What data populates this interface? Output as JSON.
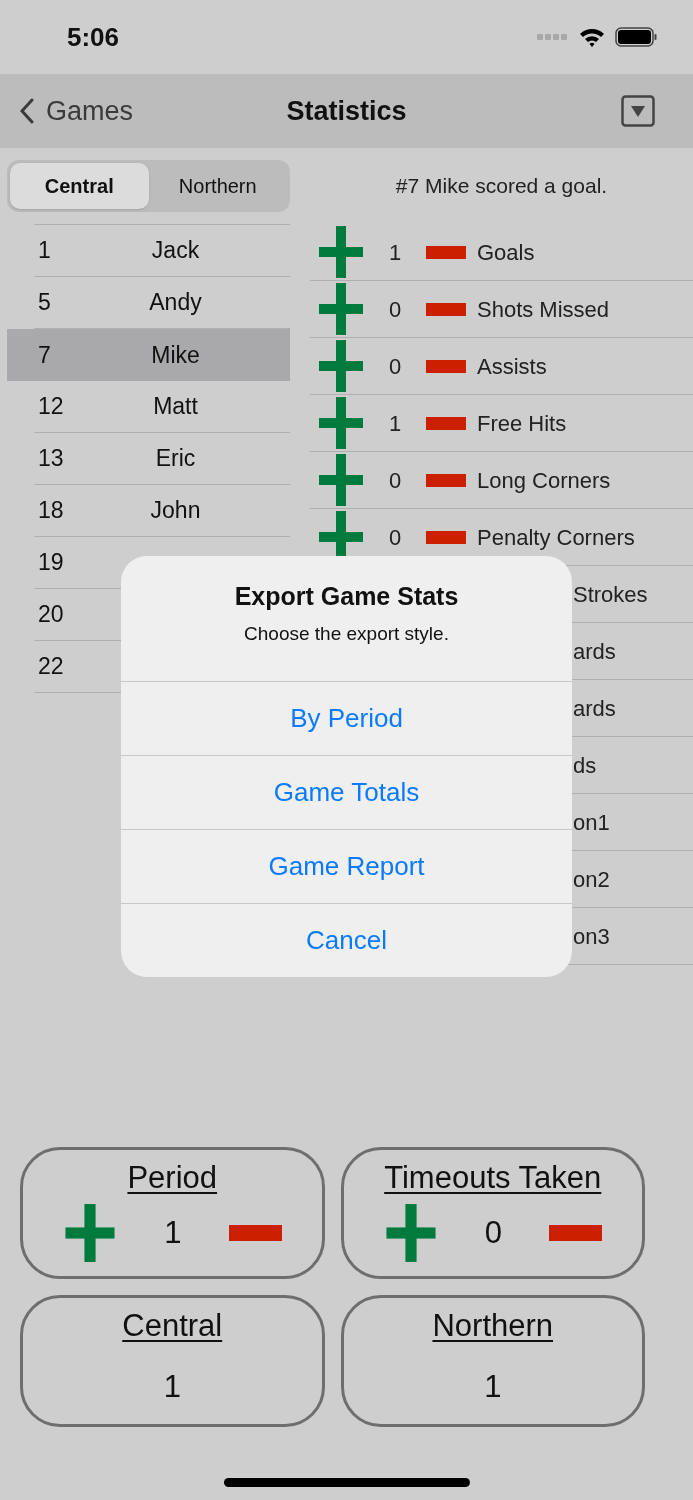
{
  "status_bar": {
    "time": "5:06"
  },
  "nav": {
    "back_label": "Games",
    "title": "Statistics"
  },
  "teams": [
    {
      "label": "Central",
      "selected": true
    },
    {
      "label": "Northern",
      "selected": false
    }
  ],
  "message": "#7 Mike scored a goal.",
  "players": [
    {
      "number": "1",
      "name": "Jack",
      "selected": false
    },
    {
      "number": "5",
      "name": "Andy",
      "selected": false
    },
    {
      "number": "7",
      "name": "Mike",
      "selected": true
    },
    {
      "number": "12",
      "name": "Matt",
      "selected": false
    },
    {
      "number": "13",
      "name": "Eric",
      "selected": false
    },
    {
      "number": "18",
      "name": "John",
      "selected": false
    },
    {
      "number": "19",
      "selected": false
    },
    {
      "number": "20",
      "selected": false
    },
    {
      "number": "22",
      "selected": false
    }
  ],
  "stats": [
    {
      "kind": "full",
      "value": "1",
      "label": "Goals"
    },
    {
      "kind": "full",
      "value": "0",
      "label": "Shots Missed"
    },
    {
      "kind": "full",
      "value": "0",
      "label": "Assists"
    },
    {
      "kind": "full",
      "value": "1",
      "label": "Free Hits"
    },
    {
      "kind": "full",
      "value": "0",
      "label": "Long Corners"
    },
    {
      "kind": "full",
      "value": "0",
      "label": "Penalty Corners"
    },
    {
      "kind": "covered",
      "label": "Strokes"
    },
    {
      "kind": "covered",
      "label": "ards"
    },
    {
      "kind": "covered",
      "label": "ards"
    },
    {
      "kind": "covered",
      "label": "ds"
    },
    {
      "kind": "covered",
      "label": "on1"
    },
    {
      "kind": "covered",
      "label": "on2"
    },
    {
      "kind": "covered",
      "label": "on3"
    }
  ],
  "dialog": {
    "title": "Export Game Stats",
    "message": "Choose the export style.",
    "actions": [
      "By Period",
      "Game Totals",
      "Game Report",
      "Cancel"
    ]
  },
  "counters": [
    {
      "kind": "stepper",
      "title": "Period",
      "value": "1"
    },
    {
      "kind": "stepper",
      "title": "Timeouts Taken",
      "value": "0"
    },
    {
      "kind": "score",
      "title": "Central",
      "value": "1"
    },
    {
      "kind": "score",
      "title": "Northern",
      "value": "1"
    }
  ]
}
